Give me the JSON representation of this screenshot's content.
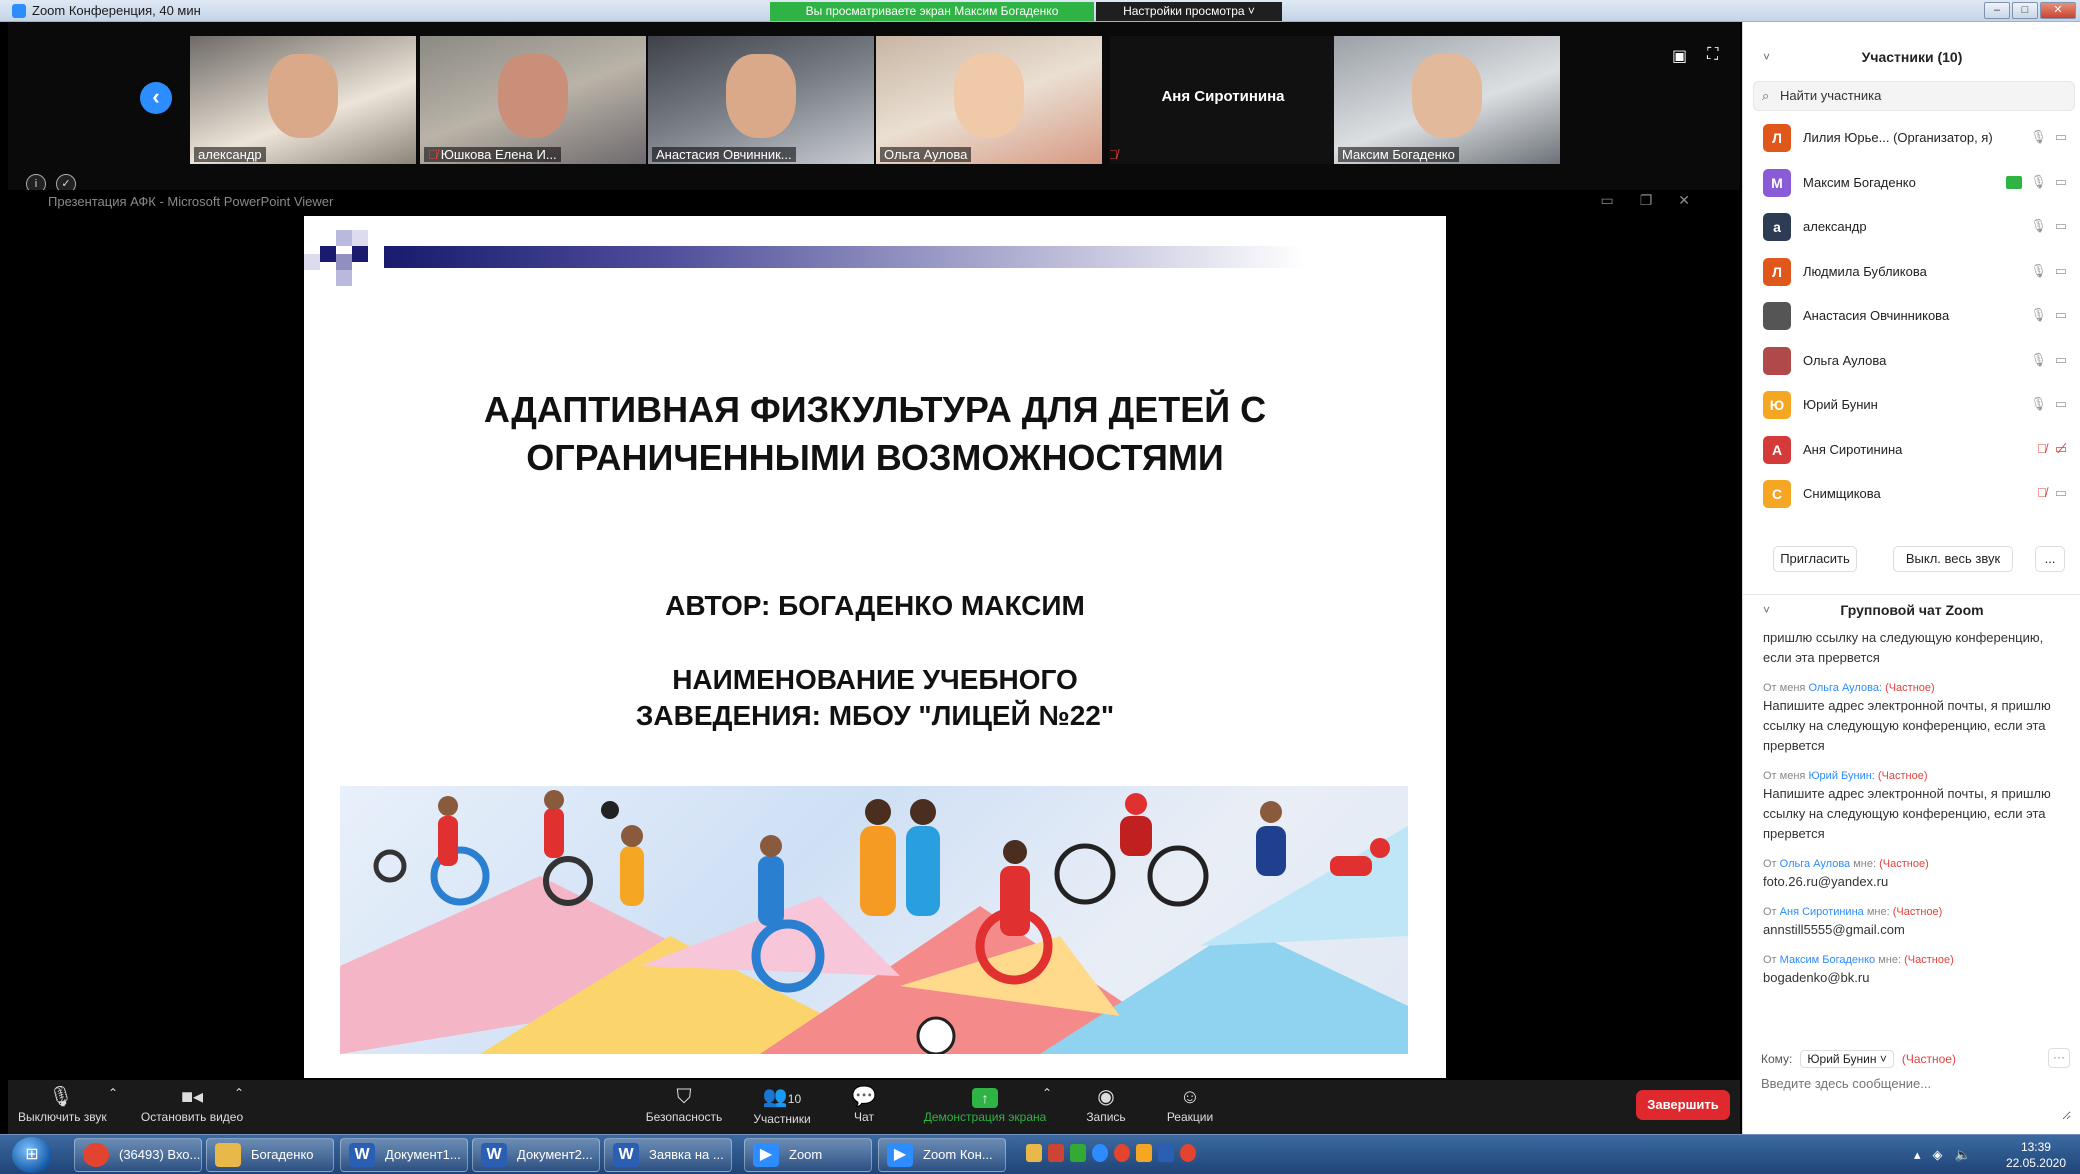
{
  "titlebar": {
    "title": "Zoom Конференция, 40 мин",
    "share_banner": "Вы просматриваете экран Максим Богаденко",
    "view_options": "Настройки просмотра ˅"
  },
  "tiles": [
    {
      "name": "александр",
      "muted": false
    },
    {
      "name": "Юшкова Елена И...",
      "muted": true
    },
    {
      "name": "Анастасия Овчинник...",
      "muted": false
    },
    {
      "name": "Ольга Аулова",
      "muted": false
    },
    {
      "name": "Аня Сиротинина",
      "muted": true
    },
    {
      "name": "Максим Богаденко",
      "muted": false
    }
  ],
  "ppt": {
    "title": "Презентация АФК - Microsoft PowerPoint Viewer"
  },
  "slide": {
    "title_line1": "АДАПТИВНАЯ ФИЗКУЛЬТУРА ДЛЯ ДЕТЕЙ С",
    "title_line2": "ОГРАНИЧЕННЫМИ ВОЗМОЖНОСТЯМИ",
    "author": "АВТОР: БОГАДЕНКО МАКСИМ",
    "school_line1": "НАИМЕНОВАНИЕ УЧЕБНОГО",
    "school_line2": "ЗАВЕДЕНИЯ: МБОУ \"ЛИЦЕЙ №22\""
  },
  "participants": {
    "header": "Участники (10)",
    "search_placeholder": "Найти участника",
    "items": [
      {
        "initial": "Л",
        "name": "Лилия Юрье...  (Организатор, я)",
        "color": "#e0571b"
      },
      {
        "initial": "М",
        "name": "Максим Богаденко",
        "color": "#8a5bd6"
      },
      {
        "initial": "а",
        "name": "александр",
        "color": "#2e3b55"
      },
      {
        "initial": "Л",
        "name": "Людмила Бубликова",
        "color": "#e0571b"
      },
      {
        "initial": "",
        "name": "Анастасия Овчинникова",
        "color": "#555555"
      },
      {
        "initial": "",
        "name": "Ольга Аулова",
        "color": "#b04a4a"
      },
      {
        "initial": "Ю",
        "name": "Юрий Бунин",
        "color": "#f5a623"
      },
      {
        "initial": "А",
        "name": "Аня Сиротинина",
        "color": "#d43a3a"
      },
      {
        "initial": "С",
        "name": "Снимщикова",
        "color": "#f5a623"
      }
    ],
    "invite_label": "Пригласить",
    "mute_all_label": "Выкл. весь звук",
    "more_label": "..."
  },
  "chat": {
    "header": "Групповой чат Zoom",
    "messages": [
      {
        "from": "",
        "who": "",
        "to": "",
        "priv": "",
        "text": "пришлю ссылку на следующую конференцию, если эта прервется"
      },
      {
        "from": "От меня",
        "who": "Ольга Аулова:",
        "to": "",
        "priv": "(Частное)",
        "text": "Напишите адрес электронной почты, я пришлю ссылку на следующую конференцию, если эта прервется"
      },
      {
        "from": "От меня",
        "who": "Юрий Бунин:",
        "to": "",
        "priv": "(Частное)",
        "text": "Напишите адрес электронной почты, я пришлю ссылку на следующую конференцию, если эта прервется"
      },
      {
        "from": "От",
        "who": "Ольга Аулова",
        "to": "мне:",
        "priv": "(Частное)",
        "text": "foto.26.ru@yandex.ru"
      },
      {
        "from": "От",
        "who": "Аня Сиротинина",
        "to": "мне:",
        "priv": "(Частное)",
        "text": "annstill5555@gmail.com"
      },
      {
        "from": "От",
        "who": "Максим Богаденко",
        "to": "мне:",
        "priv": "(Частное)",
        "text": "bogadenko@bk.ru"
      }
    ],
    "to_label": "Кому:",
    "to_value": "Юрий Бунин ˅",
    "to_priv": "(Частное)",
    "input_placeholder": "Введите здесь сообщение..."
  },
  "toolbar": {
    "mute": "Выключить звук",
    "video": "Остановить видео",
    "security": "Безопасность",
    "participants": "Участники",
    "participants_count": "10",
    "chat": "Чат",
    "share": "Демонстрация экрана",
    "record": "Запись",
    "reactions": "Реакции",
    "end": "Завершить"
  },
  "taskbar": {
    "tasks": [
      {
        "label": "(36493) Вхо...",
        "icon": "chrome-icon",
        "color": "#e2442f"
      },
      {
        "label": "Богаденко",
        "icon": "folder-icon",
        "color": "#e8b84a"
      },
      {
        "label": "Документ1...",
        "icon": "word-icon",
        "color": "#2b5fb4"
      },
      {
        "label": "Документ2...",
        "icon": "word-icon",
        "color": "#2b5fb4"
      },
      {
        "label": "Заявка на ...",
        "icon": "word-icon",
        "color": "#2b5fb4"
      },
      {
        "label": "Zoom",
        "icon": "zoom-icon",
        "color": "#2d8cff"
      },
      {
        "label": "Zoom Кон...",
        "icon": "zoom-icon",
        "color": "#2d8cff"
      }
    ],
    "time": "13:39",
    "date": "22.05.2020"
  }
}
